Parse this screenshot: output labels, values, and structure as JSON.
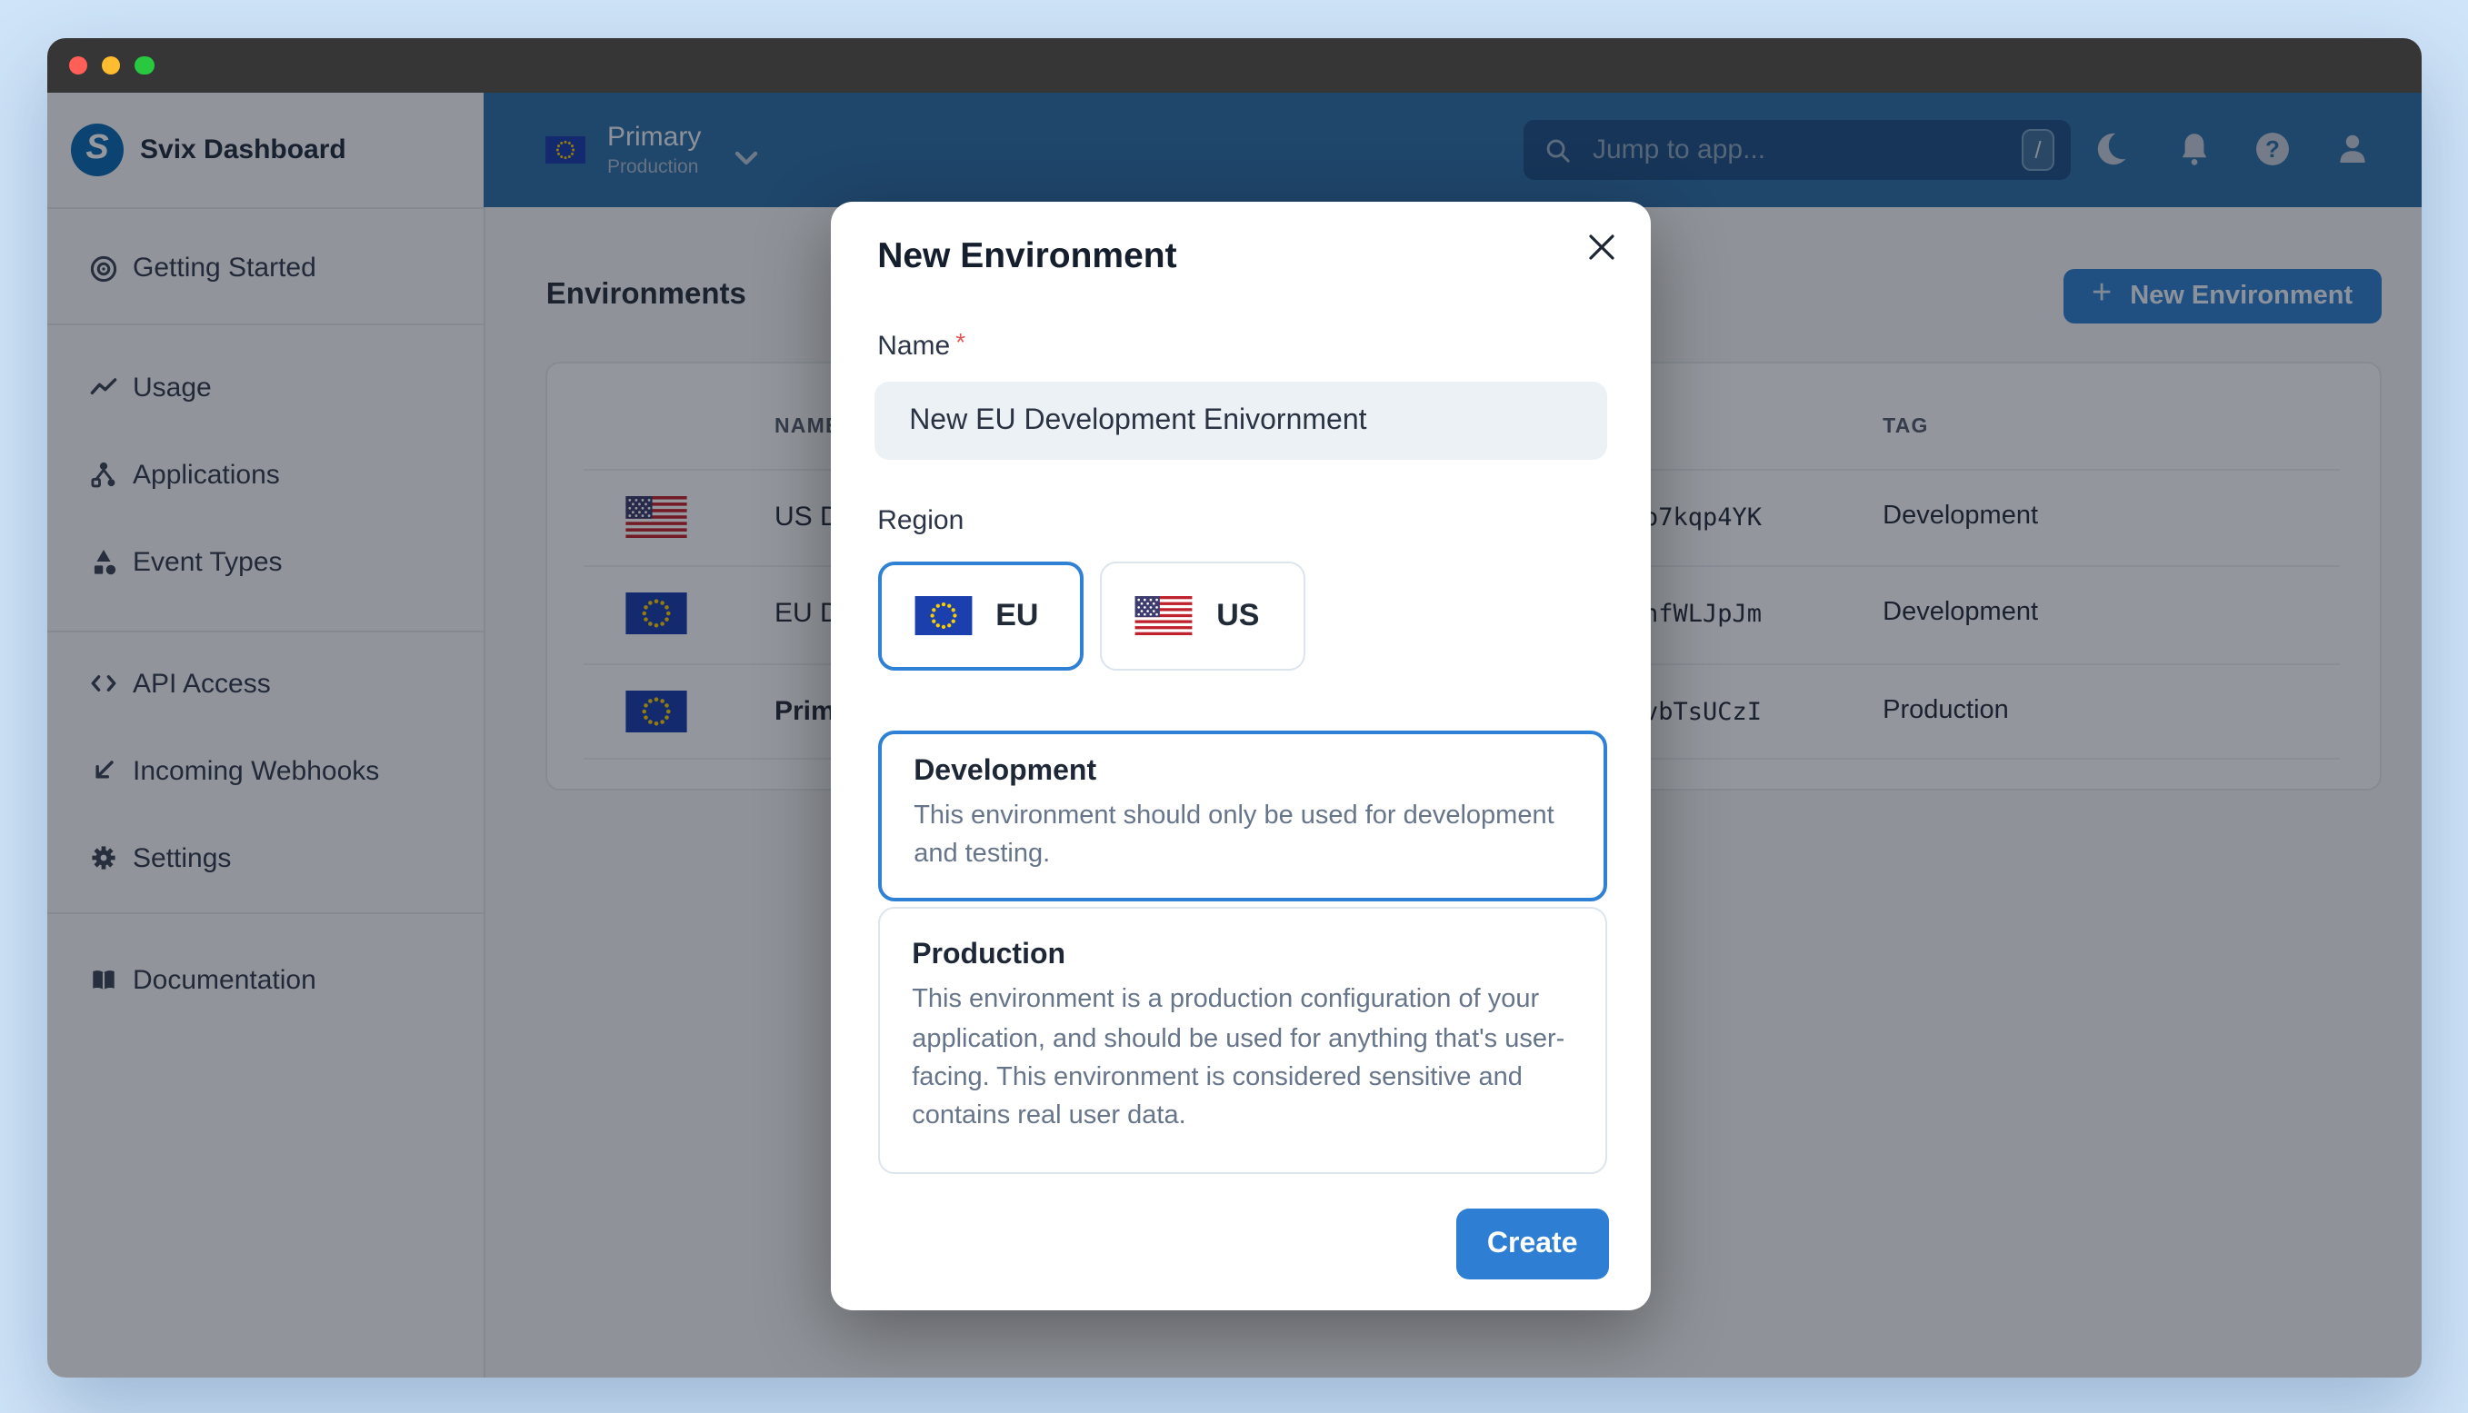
{
  "brand": {
    "name": "Svix Dashboard",
    "logo_letter": "S"
  },
  "sidebar": {
    "items": [
      {
        "label": "Getting Started",
        "icon": "target-icon"
      },
      {
        "label": "Usage",
        "icon": "trend-line-icon"
      },
      {
        "label": "Applications",
        "icon": "nodes-icon"
      },
      {
        "label": "Event Types",
        "icon": "shapes-icon"
      },
      {
        "label": "API Access",
        "icon": "code-icon"
      },
      {
        "label": "Incoming Webhooks",
        "icon": "arrow-down-left-icon"
      },
      {
        "label": "Settings",
        "icon": "gear-icon"
      },
      {
        "label": "Documentation",
        "icon": "book-icon"
      }
    ]
  },
  "topbar": {
    "environment": {
      "name": "Primary",
      "tag": "Production",
      "flag": "eu"
    },
    "search": {
      "placeholder": "Jump to app...",
      "shortcut_key": "/"
    },
    "icons": [
      "moon-icon",
      "bell-icon",
      "help-icon",
      "user-icon"
    ]
  },
  "page": {
    "heading": "Environments",
    "new_environment_button": "New Environment",
    "plus_glyph": "+",
    "table": {
      "columns": {
        "name": "NAME",
        "tag": "TAG"
      },
      "rows": [
        {
          "flag": "us",
          "name_visible": "US D",
          "id_visible": "o7kqp4YK",
          "tag": "Development"
        },
        {
          "flag": "eu",
          "name_visible": "EU D",
          "id_visible": "nfWLJpJm",
          "tag": "Development"
        },
        {
          "flag": "eu",
          "name_visible": "Prim",
          "id_visible": "vbTsUCzI",
          "tag": "Production"
        }
      ]
    }
  },
  "modal": {
    "title": "New Environment",
    "name_field": {
      "label": "Name",
      "required_mark": "*",
      "value": "New EU Development Enivornment"
    },
    "region": {
      "label": "Region",
      "options": [
        {
          "code": "EU",
          "flag": "eu",
          "selected": true
        },
        {
          "code": "US",
          "flag": "us",
          "selected": false
        }
      ]
    },
    "environment_types": [
      {
        "title": "Development",
        "selected": true,
        "description": "This environment should only be used for development and testing.",
        "lines": [
          "This environment should only be used for development",
          "and testing."
        ]
      },
      {
        "title": "Production",
        "selected": false,
        "description": "This environment is a production configuration of your application, and should be used for anything that's user-facing. This environment is considered sensitive and contains real user data.",
        "lines": [
          "This environment is a production configuration of your",
          "application, and should be used for anything that's user-",
          "facing. This environment is considered sensitive and",
          "contains real user data."
        ]
      }
    ],
    "create_button": "Create"
  },
  "colors": {
    "desktop_background": "#cfe4f8",
    "titlebar": "#363636",
    "traffic_red": "#ff5f57",
    "traffic_yellow": "#febc2e",
    "traffic_green": "#28c840",
    "topbar_blue": "#2e6fa8",
    "primary_blue": "#2f81d6",
    "create_button_blue": "#2e7fd4",
    "backdrop": "rgba(12,17,27,0.43)"
  }
}
